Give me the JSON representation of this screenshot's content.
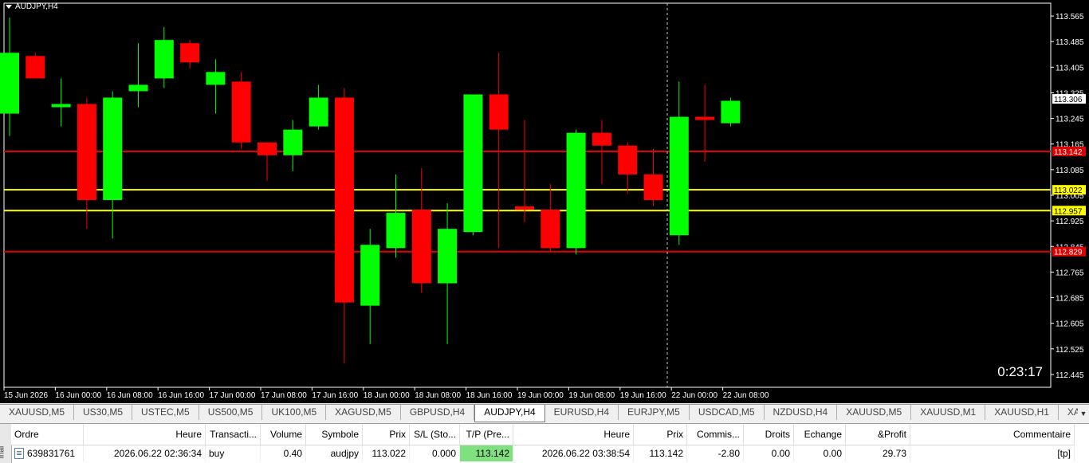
{
  "chart": {
    "title": "AUDJPY,H4",
    "timer": "0:23:17",
    "price_axis": [
      "113.565",
      "113.485",
      "113.405",
      "113.325",
      "113.245",
      "113.165",
      "113.085",
      "113.005",
      "112.925",
      "112.845",
      "112.765",
      "112.685",
      "112.605",
      "112.525",
      "112.445"
    ],
    "time_axis": [
      "15 Jun 2026",
      "16 Jun 00:00",
      "16 Jun 08:00",
      "16 Jun 16:00",
      "17 Jun 00:00",
      "17 Jun 08:00",
      "17 Jun 16:00",
      "18 Jun 00:00",
      "18 Jun 08:00",
      "18 Jun 16:00",
      "19 Jun 00:00",
      "19 Jun 08:00",
      "19 Jun 16:00",
      "22 Jun 00:00",
      "22 Jun 08:00"
    ],
    "levels": [
      {
        "price": 113.142,
        "label": "113.142",
        "color": "#e00000",
        "text_color": "#ffffff"
      },
      {
        "price": 113.022,
        "label": "113.022",
        "color": "#ffff00",
        "text_color": "#000000"
      },
      {
        "price": 112.957,
        "label": "112.957",
        "color": "#ffff00",
        "text_color": "#000000"
      },
      {
        "price": 112.829,
        "label": "112.829",
        "color": "#e00000",
        "text_color": "#ffffff"
      }
    ],
    "current_price": "113.306",
    "up_color": "#00ff00",
    "down_color": "#ff0000",
    "candles": [
      {
        "o": 113.26,
        "h": 113.56,
        "l": 113.19,
        "c": 113.45
      },
      {
        "o": 113.44,
        "h": 113.45,
        "l": 113.38,
        "c": 113.37
      },
      {
        "o": 113.28,
        "h": 113.37,
        "l": 113.22,
        "c": 113.29
      },
      {
        "o": 113.29,
        "h": 113.31,
        "l": 112.9,
        "c": 112.99
      },
      {
        "o": 112.99,
        "h": 113.33,
        "l": 112.87,
        "c": 113.31
      },
      {
        "o": 113.33,
        "h": 113.48,
        "l": 113.28,
        "c": 113.35
      },
      {
        "o": 113.37,
        "h": 113.53,
        "l": 113.34,
        "c": 113.49
      },
      {
        "o": 113.48,
        "h": 113.49,
        "l": 113.4,
        "c": 113.42
      },
      {
        "o": 113.35,
        "h": 113.43,
        "l": 113.26,
        "c": 113.39
      },
      {
        "o": 113.36,
        "h": 113.39,
        "l": 113.15,
        "c": 113.17
      },
      {
        "o": 113.17,
        "h": 113.17,
        "l": 113.05,
        "c": 113.13
      },
      {
        "o": 113.13,
        "h": 113.24,
        "l": 113.08,
        "c": 113.21
      },
      {
        "o": 113.22,
        "h": 113.35,
        "l": 113.21,
        "c": 113.31
      },
      {
        "o": 113.31,
        "h": 113.34,
        "l": 112.48,
        "c": 112.67
      },
      {
        "o": 112.66,
        "h": 112.9,
        "l": 112.54,
        "c": 112.85
      },
      {
        "o": 112.84,
        "h": 113.07,
        "l": 112.81,
        "c": 112.95
      },
      {
        "o": 112.96,
        "h": 113.09,
        "l": 112.7,
        "c": 112.73
      },
      {
        "o": 112.73,
        "h": 112.98,
        "l": 112.54,
        "c": 112.9
      },
      {
        "o": 112.89,
        "h": 113.32,
        "l": 112.88,
        "c": 113.32
      },
      {
        "o": 113.32,
        "h": 113.45,
        "l": 112.84,
        "c": 113.21
      },
      {
        "o": 112.97,
        "h": 113.24,
        "l": 112.92,
        "c": 112.96
      },
      {
        "o": 112.96,
        "h": 113.04,
        "l": 112.83,
        "c": 112.84
      },
      {
        "o": 112.84,
        "h": 113.21,
        "l": 112.82,
        "c": 113.2
      },
      {
        "o": 113.2,
        "h": 113.24,
        "l": 113.04,
        "c": 113.16
      },
      {
        "o": 113.16,
        "h": 113.17,
        "l": 113.01,
        "c": 113.07
      },
      {
        "o": 113.07,
        "h": 113.15,
        "l": 112.97,
        "c": 112.99
      },
      {
        "o": 112.88,
        "h": 113.36,
        "l": 112.85,
        "c": 113.25
      },
      {
        "o": 113.25,
        "h": 113.35,
        "l": 113.11,
        "c": 113.24
      },
      {
        "o": 113.23,
        "h": 113.31,
        "l": 113.22,
        "c": 113.3
      }
    ]
  },
  "tabs": [
    {
      "label": "XAUUSD,M5",
      "active": false
    },
    {
      "label": "US30,M5",
      "active": false
    },
    {
      "label": "USTEC,M5",
      "active": false
    },
    {
      "label": "US500,M5",
      "active": false
    },
    {
      "label": "UK100,M5",
      "active": false
    },
    {
      "label": "XAGUSD,M5",
      "active": false
    },
    {
      "label": "GBPUSD,H4",
      "active": false
    },
    {
      "label": "AUDJPY,H4",
      "active": true
    },
    {
      "label": "EURUSD,H4",
      "active": false
    },
    {
      "label": "EURJPY,M5",
      "active": false
    },
    {
      "label": "USDCAD,M5",
      "active": false
    },
    {
      "label": "NZDUSD,H4",
      "active": false
    },
    {
      "label": "XAUUSD,M5",
      "active": false
    },
    {
      "label": "XAUUSD,M1",
      "active": false
    },
    {
      "label": "XAUUSD,H1",
      "active": false
    },
    {
      "label": "XAUUSD,Wee",
      "active": false
    }
  ],
  "terminal": {
    "side_label": "inal",
    "headers": [
      "Ordre",
      "Heure",
      "Transacti...",
      "Volume",
      "Symbole",
      "Prix",
      "S/L (Sto...",
      "T/P (Pre...",
      "Heure",
      "Prix",
      "Commis...",
      "Droits",
      "Echange",
      "&Profit",
      "Commentaire"
    ],
    "row": [
      "639831761",
      "2026.06.22 02:36:34",
      "buy",
      "0.40",
      "audjpy",
      "113.022",
      "0.000",
      "113.142",
      "2026.06.22 03:38:54",
      "113.142",
      "-2.80",
      "0.00",
      "0.00",
      "29.73",
      "[tp]"
    ]
  }
}
